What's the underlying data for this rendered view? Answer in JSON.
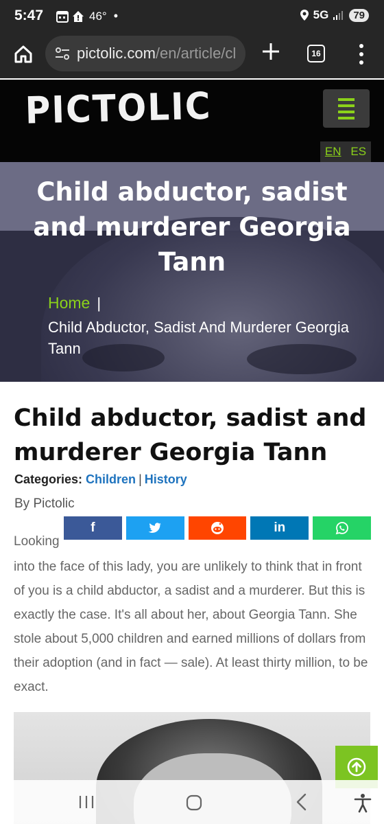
{
  "status_bar": {
    "time": "5:47",
    "temperature": "46°",
    "network": "5G",
    "battery": "79",
    "icons": [
      "calendar-icon",
      "home-alert-icon",
      "location-icon",
      "signal-icon"
    ]
  },
  "browser": {
    "url_host": "pictolic.com",
    "url_path": "/en/article/cl",
    "tab_count": "16"
  },
  "site": {
    "logo": "PICTOLIC",
    "lang_en": "EN",
    "lang_es": "ES",
    "accent_color": "#8bd11a"
  },
  "hero": {
    "title": "Child abductor, sadist and murderer Georgia Tann",
    "breadcrumb_home": "Home",
    "breadcrumb_sep": "|",
    "breadcrumb_current": "Child Abductor, Sadist And Murderer Georgia Tann"
  },
  "article": {
    "title": "Child abductor, sadist and murderer Georgia Tann",
    "categories_label": "Categories:",
    "categories": [
      "Children",
      "History"
    ],
    "category_sep": "|",
    "byline": "By Pictolic",
    "intro_first_word": "Looking",
    "intro_rest": "into the face of this lady, you are unlikely to think that in front of you is a child abductor, a sadist and a murderer. But this is exactly the case. It's all about her, about Georgia Tann. She stole about 5,000 children and earned millions of dollars from their adoption (and in fact — sale). At least thirty million, to be exact."
  },
  "share": [
    {
      "name": "facebook",
      "glyph": "f",
      "color": "#3b5998"
    },
    {
      "name": "twitter",
      "glyph": "",
      "color": "#1da1f2"
    },
    {
      "name": "reddit",
      "glyph": "",
      "color": "#ff4500"
    },
    {
      "name": "linkedin",
      "glyph": "in",
      "color": "#0077b5"
    },
    {
      "name": "whatsapp",
      "glyph": "",
      "color": "#25d366"
    }
  ]
}
